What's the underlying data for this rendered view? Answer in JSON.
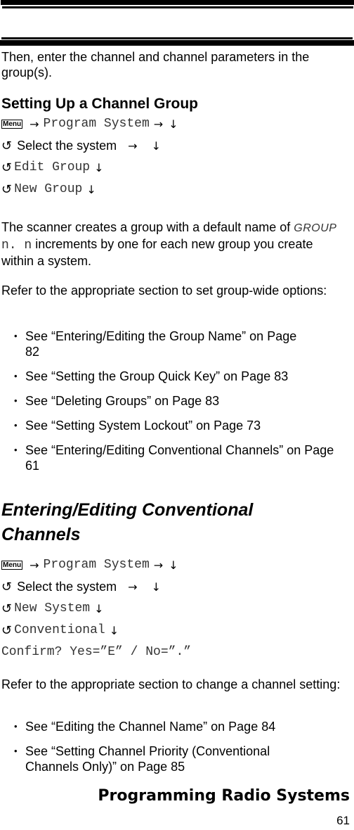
{
  "intro": "Then, enter the channel and channel parameters in the group(s).",
  "section1": {
    "heading": "Setting Up a Channel Group",
    "steps": {
      "menu_key": "Menu",
      "s1": "Program System",
      "s2": "Select the system",
      "s3": "Edit Group",
      "s4": "New Group"
    },
    "para1_lcd": "GROUP",
    "para1_before": "The scanner creates a group with a default name of",
    "para1_mono": "n. n",
    "para1_after": "increments by one for each new group you create within a system.",
    "para2": "Refer to the appropriate section to set group-wide options:",
    "bullets": [
      "See “Entering/Editing the Group Name” on Page 82",
      "See “Setting the Group Quick Key” on Page 83",
      "See “Deleting Groups” on Page 83",
      "See “Setting System Lockout” on Page 73",
      "See “Entering/Editing Conventional Channels” on Page 61"
    ]
  },
  "section2": {
    "heading": "Entering/Editing Conventional Channels",
    "steps": {
      "menu_key": "Menu",
      "s1": "Program System",
      "s2": "Select the system",
      "s3": "New System",
      "s4": "Conventional",
      "confirm": "Confirm? Yes=”E” / No=”.”"
    },
    "para": "Refer to the appropriate section to change a channel setting:",
    "bullets": [
      "See “Editing the Channel Name” on Page 84",
      "See “Setting Channel Priority (Conventional Channels Only)” on Page 85"
    ]
  },
  "footer": {
    "chapter": "Programming Radio Systems",
    "page": "61"
  },
  "icons": {
    "right": "→",
    "down": "↓",
    "knob": "↻"
  }
}
